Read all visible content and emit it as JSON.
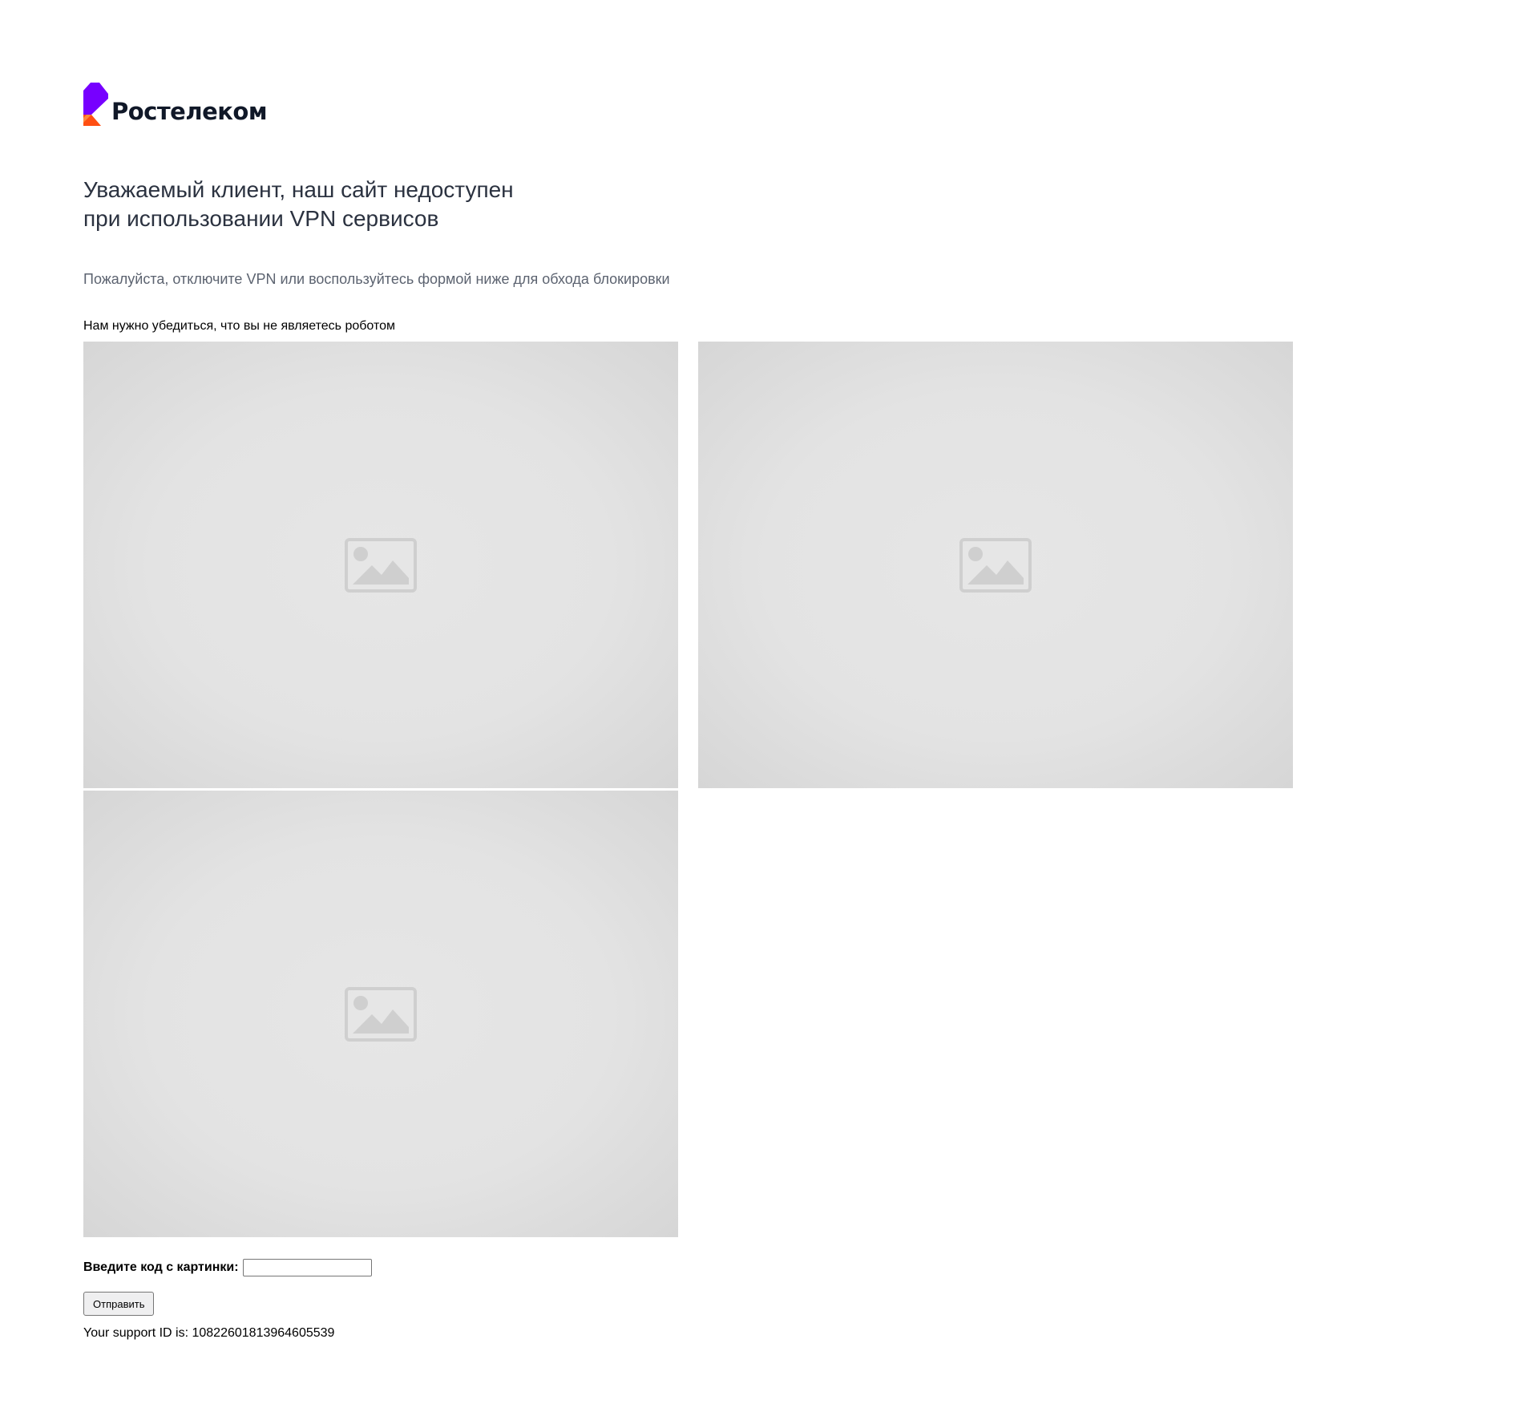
{
  "brand": {
    "name": "Ростелеком",
    "colors": {
      "purple": "#7700ff",
      "orange": "#ff4f12",
      "text": "#101828"
    }
  },
  "headline": {
    "line1": "Уважаемый клиент, наш сайт недоступен",
    "line2": "при использовании VPN сервисов"
  },
  "subtitle": "Пожалуйста, отключите VPN или воспользуйтесь формой ниже для обхода блокировки",
  "robot_note": "Нам нужно убедиться, что вы не являетесь роботом",
  "captcha": {
    "images": [
      {
        "icon": "image-placeholder-icon"
      },
      {
        "icon": "image-placeholder-icon"
      },
      {
        "icon": "image-placeholder-icon"
      }
    ],
    "code_label": "Введите код с картинки:",
    "code_value": "",
    "submit_label": "Отправить"
  },
  "support": {
    "text": "Your support ID is: 10822601813964605539"
  }
}
